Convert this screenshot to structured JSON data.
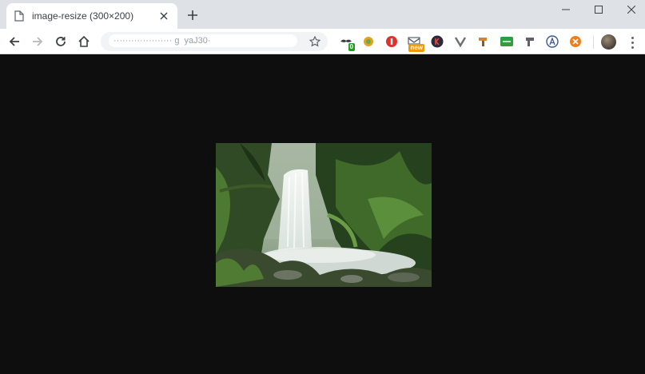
{
  "tab": {
    "title": "image-resize (300×200)",
    "favicon": "document-icon",
    "close_icon": "close-icon"
  },
  "window_controls": [
    "minimize-icon",
    "maximize-icon",
    "close-window-icon"
  ],
  "omnibox": {
    "url": "···················· g  yaJ30·"
  },
  "extensions": [
    {
      "icon": "mustache-extension-icon",
      "badge": "0",
      "badge_color": "#1aa31a"
    },
    {
      "icon": "gear-extension-icon",
      "badge": "",
      "badge_color": ""
    },
    {
      "icon": "shield-extension-icon",
      "badge": "",
      "badge_color": ""
    },
    {
      "icon": "mail-extension-icon",
      "badge": "new",
      "badge_color": "#f29900"
    },
    {
      "icon": "k-extension-icon",
      "badge": "",
      "badge_color": ""
    },
    {
      "icon": "v-extension-icon",
      "badge": "",
      "badge_color": ""
    },
    {
      "icon": "hammer-extension-icon",
      "badge": "",
      "badge_color": ""
    },
    {
      "icon": "cors-extension-icon",
      "badge": "",
      "badge_color": ""
    },
    {
      "icon": "pin-extension-icon",
      "badge": "",
      "badge_color": ""
    },
    {
      "icon": "a-extension-icon",
      "badge": "",
      "badge_color": ""
    },
    {
      "icon": "block-extension-icon",
      "badge": "",
      "badge_color": ""
    }
  ],
  "content": {
    "image_alt": "waterfall in a rainforest",
    "background": "#0e0e0e"
  }
}
